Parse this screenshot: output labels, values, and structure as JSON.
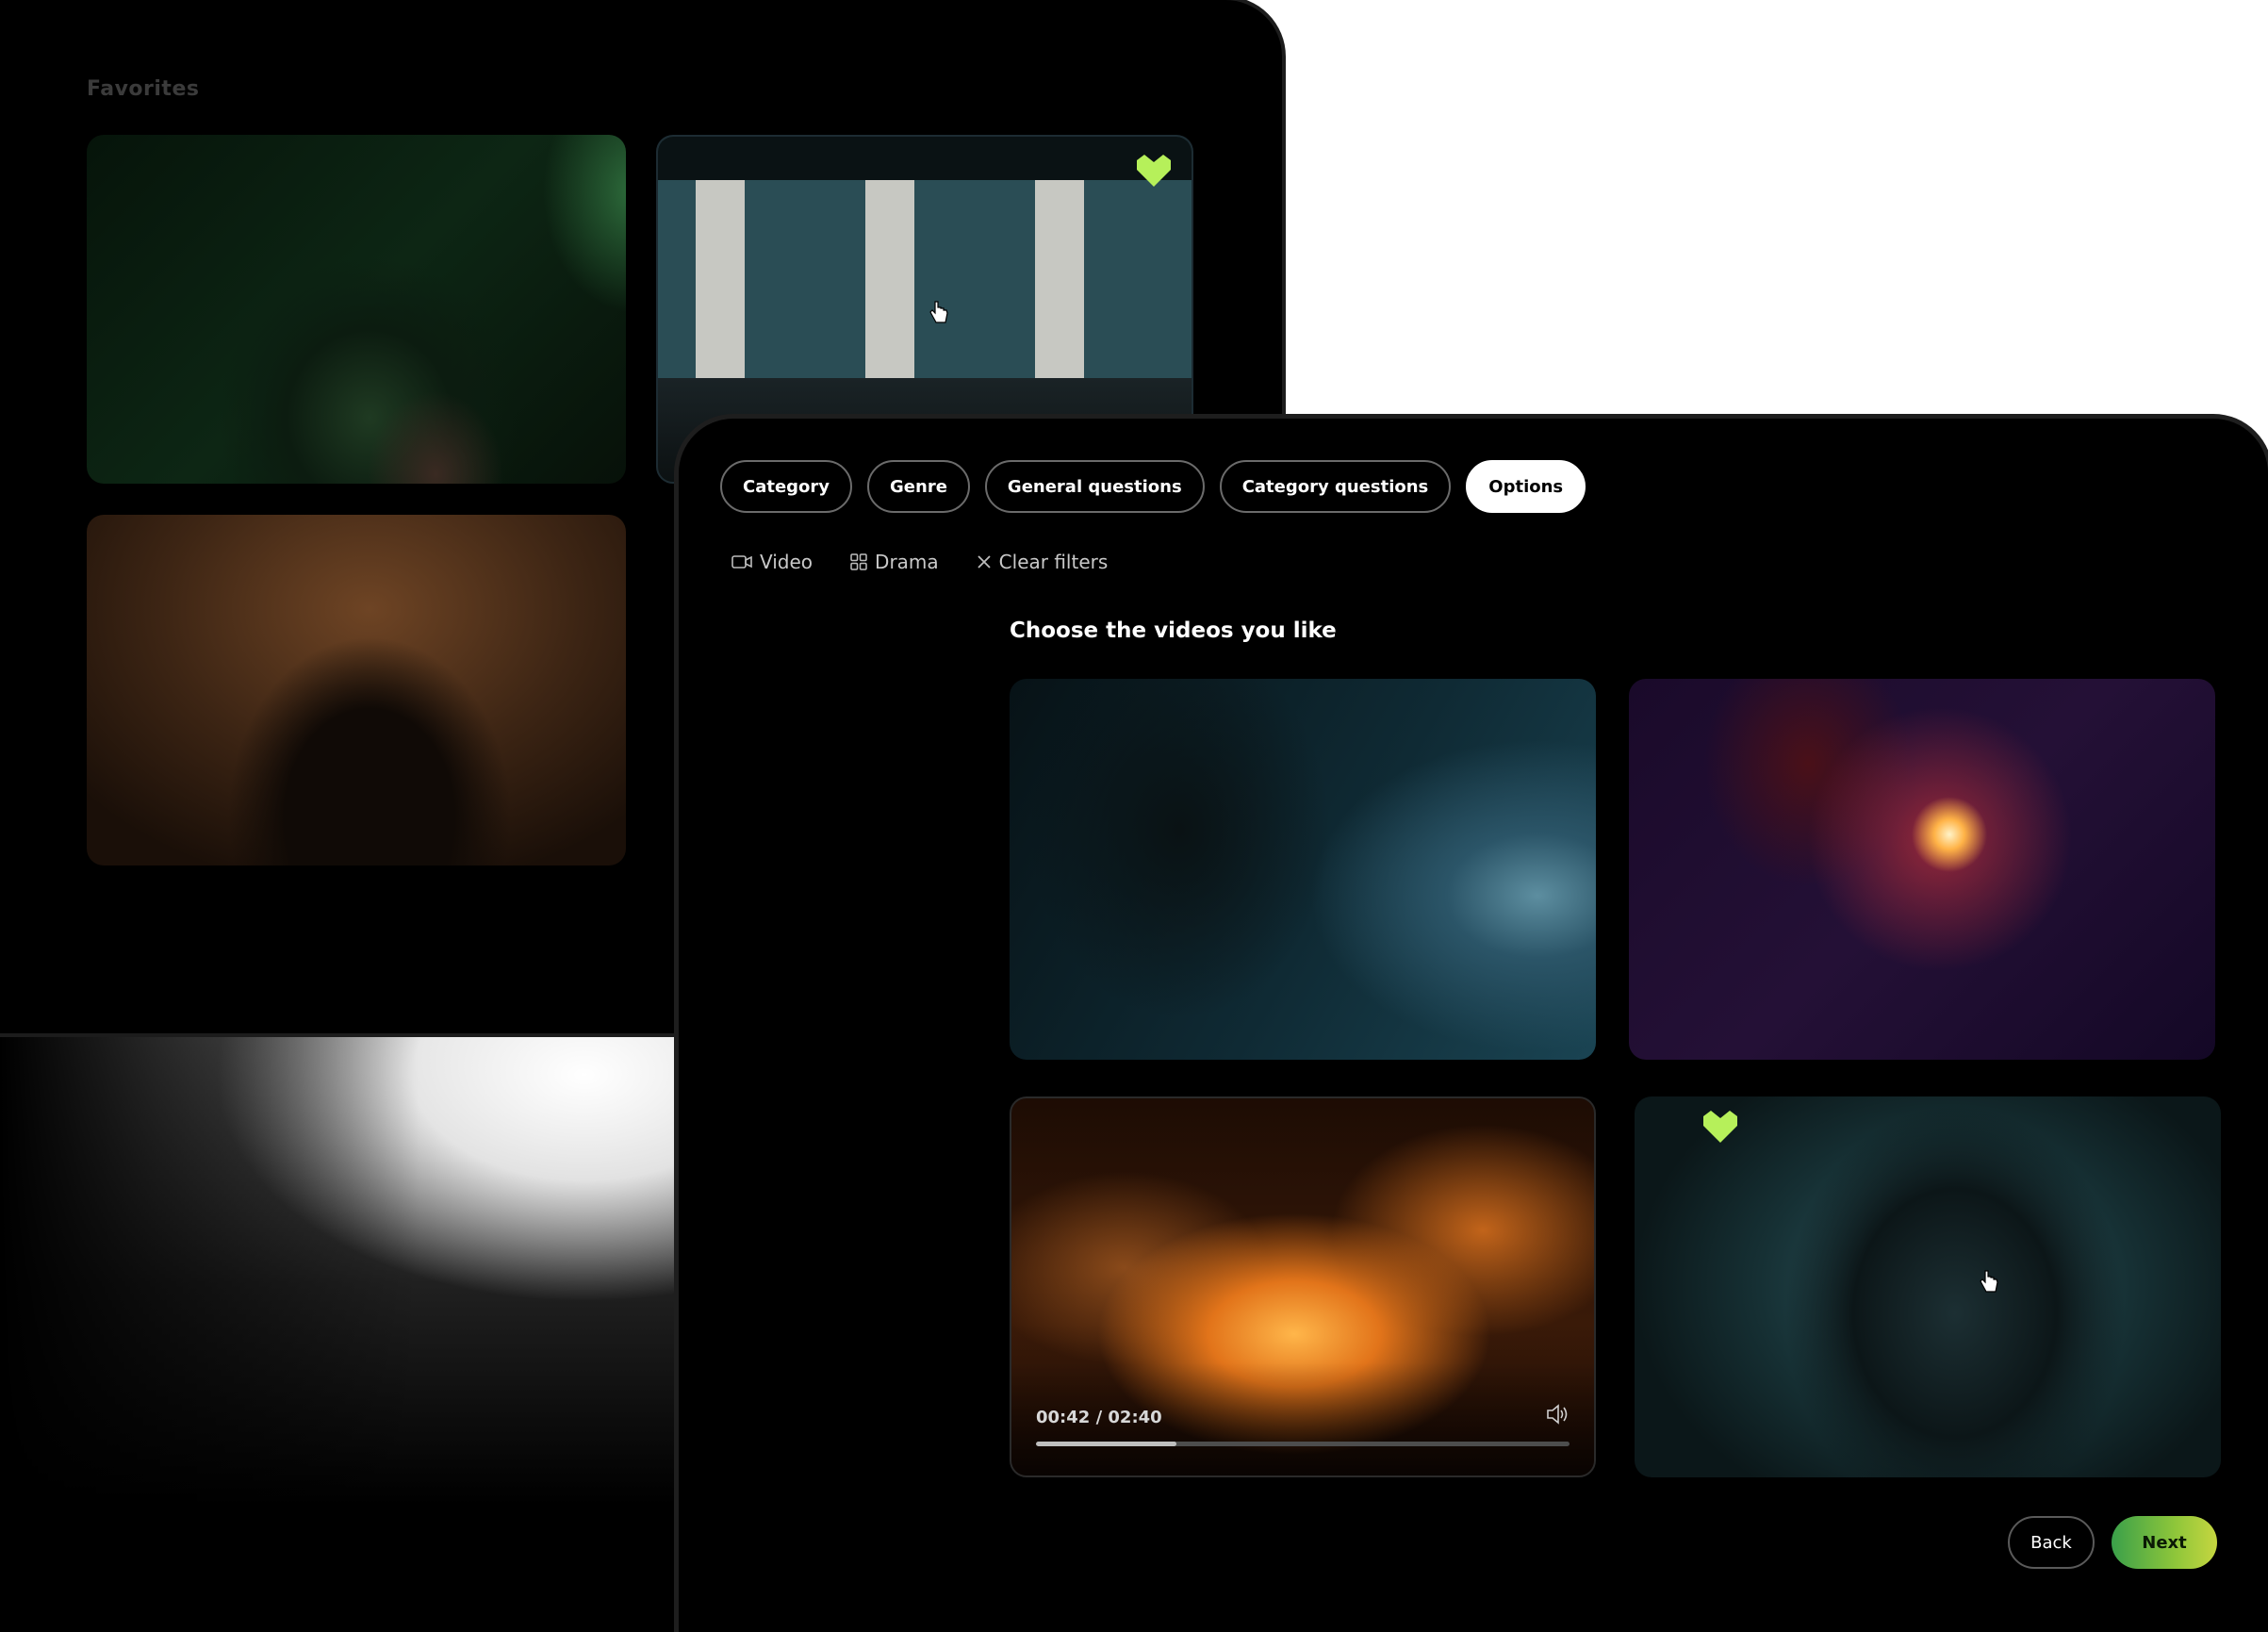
{
  "favorites": {
    "title": "Favorites"
  },
  "tabs": [
    {
      "label": "Category"
    },
    {
      "label": "Genre"
    },
    {
      "label": "General questions"
    },
    {
      "label": "Category questions"
    },
    {
      "label": "Options",
      "active": true
    }
  ],
  "filters": [
    {
      "icon": "video-camera-icon",
      "label": "Video"
    },
    {
      "icon": "grid-icon",
      "label": "Drama"
    },
    {
      "icon": "close-icon",
      "label": "Clear filters"
    }
  ],
  "main": {
    "title": "Choose the videos you like"
  },
  "player": {
    "time": "00:42 / 02:40",
    "progress": 0.2625
  },
  "actions": {
    "back_label": "Back",
    "next_label": "Next"
  },
  "colors": {
    "accent": "#b6f05a",
    "next_gradient_start": "#3aa04a",
    "next_gradient_end": "#c6d640"
  }
}
